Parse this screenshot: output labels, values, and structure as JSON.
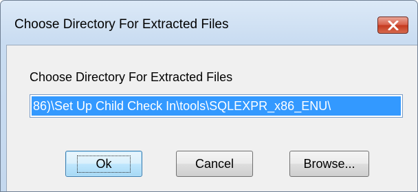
{
  "window": {
    "title": "Choose Directory For Extracted Files",
    "close_icon": "close-icon"
  },
  "form": {
    "label": "Choose Directory For Extracted Files",
    "path_value": "86)\\Set Up Child Check In\\tools\\SQLEXPR_x86_ENU\\"
  },
  "buttons": {
    "ok_label": "Ok",
    "cancel_label": "Cancel",
    "browse_label": "Browse..."
  },
  "colors": {
    "selection": "#3399ff",
    "close_button": "#c5391f",
    "title_gradient_top": "#dce9f7"
  }
}
